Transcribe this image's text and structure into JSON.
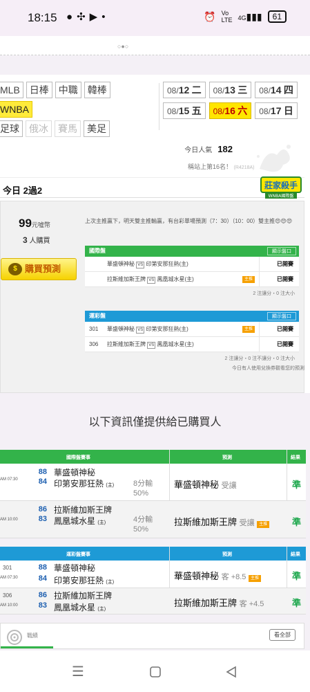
{
  "status_bar": {
    "time": "18:15",
    "network": "4G",
    "battery": "61"
  },
  "categories": {
    "row1": [
      "MLB",
      "日棒",
      "中職",
      "韓棒"
    ],
    "row2": [
      "WNBA"
    ],
    "row3": [
      "足球",
      "俄冰",
      "賽馬",
      "美足"
    ]
  },
  "dates": {
    "row1": [
      {
        "md": "08/",
        "d": "12",
        "wd": "二"
      },
      {
        "md": "08/",
        "d": "13",
        "wd": "三"
      },
      {
        "md": "08/",
        "d": "14",
        "wd": "四"
      }
    ],
    "row2": [
      {
        "md": "08/",
        "d": "15",
        "wd": "五"
      },
      {
        "md": "08/",
        "d": "16",
        "wd": "六"
      },
      {
        "md": "08/",
        "d": "17",
        "wd": "日"
      }
    ]
  },
  "popularity": {
    "label": "今日人氣",
    "value": "182"
  },
  "rank": {
    "text": "稱站上第16名！",
    "id": "(R4218A)"
  },
  "record": {
    "text": "今日 2過2"
  },
  "badge": {
    "title": "莊家殺手",
    "sub": "WNBA國際盤"
  },
  "purchase": {
    "price": "99",
    "price_unit": "元噓幣",
    "buyers_count": "3",
    "buyers_label": "人購買",
    "button": "購買預測"
  },
  "note": "上次主推贏下，明天雙主推輸贏，有台彩單場預測（7：30）（10：00）雙主推😍😍😍",
  "intl_table": {
    "title": "國際盤",
    "open_label": "顯示盤口",
    "rows": [
      {
        "no": "",
        "away": "華盛頓神秘",
        "home": "印第安那狂熱(主)",
        "tag": "",
        "status": "已開賽"
      },
      {
        "no": "",
        "away": "拉斯維加斯王牌",
        "home": "鳳凰城水星(主)",
        "tag": "主推",
        "status": "已開賽"
      }
    ],
    "count": "2 注讓分・0 注大小"
  },
  "lottery_table": {
    "title": "運彩盤",
    "open_label": "顯示盤口",
    "rows": [
      {
        "no": "301",
        "away": "華盛頓神秘",
        "home": "印第安那狂熱(主)",
        "tag": "主推",
        "status": "已開賽"
      },
      {
        "no": "306",
        "away": "拉斯維加斯王牌",
        "home": "鳳凰城水星(主)",
        "tag": "",
        "status": "已開賽"
      }
    ],
    "count": "2 注讓分・0 注不讓分・0 注大小",
    "exchange_note": "今日有人使用兌換券觀看您的預測"
  },
  "info_heading": "以下資訊僅提供給已購買人",
  "results_intl": {
    "header": {
      "event": "國際盤賽事",
      "pred": "預測",
      "result": "結果"
    },
    "rows": [
      {
        "time": "AM 07:30",
        "away_score": "88",
        "away": "華盛頓神秘",
        "home_score": "84",
        "home": "印第安那狂熱",
        "home_tag": "(主)",
        "margin": "8分輸",
        "pct": "50%",
        "pick": "華盛頓神秘",
        "pick_type": "受讓",
        "pick_tag": "",
        "result": "準"
      },
      {
        "time": "AM 10:00",
        "away_score": "86",
        "away": "拉斯維加斯王牌",
        "home_score": "83",
        "home": "鳳凰城水星",
        "home_tag": "(主)",
        "margin": "4分輸",
        "pct": "50%",
        "pick": "拉斯維加斯王牌",
        "pick_type": "受讓",
        "pick_tag": "主推",
        "result": "準"
      }
    ]
  },
  "results_lottery": {
    "header": {
      "event": "運彩盤賽事",
      "pred": "預測",
      "result": "結果"
    },
    "rows": [
      {
        "no": "301",
        "time": "AM 07:30",
        "away_score": "88",
        "away": "華盛頓神秘",
        "home_score": "84",
        "home": "印第安那狂熱",
        "home_tag": "(主)",
        "pick": "華盛頓神秘",
        "pick_type": "客 +8.5",
        "pick_tag": "主推",
        "result": "準"
      },
      {
        "no": "306",
        "time": "AM 10:00",
        "away_score": "86",
        "away": "拉斯維加斯王牌",
        "home_score": "83",
        "home": "鳳凰城水星",
        "home_tag": "(主)",
        "pick": "拉斯維加斯王牌",
        "pick_type": "客 +4.5",
        "pick_tag": "",
        "result": "準"
      }
    ]
  },
  "bottom": {
    "label": "戰績",
    "view_all": "看全部"
  },
  "colors": {
    "green": "#33b34a",
    "blue": "#1e9ad6",
    "yellow": "#ffe600",
    "orange": "#f6a000"
  }
}
